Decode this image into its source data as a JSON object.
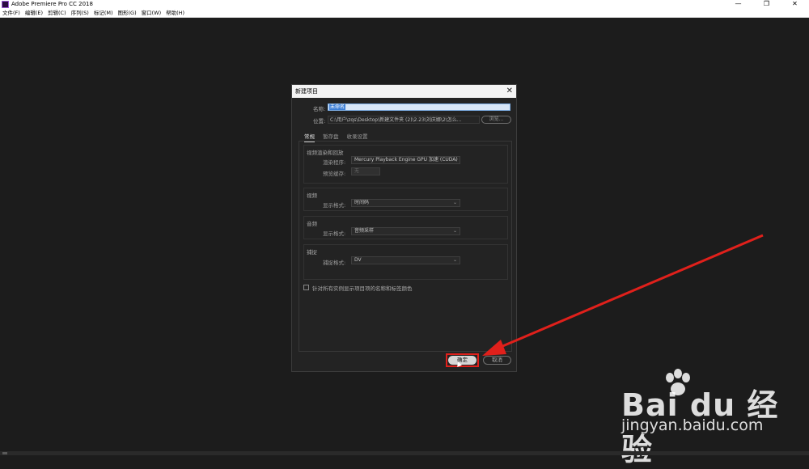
{
  "window": {
    "title": "Adobe Premiere Pro CC 2018",
    "controls": [
      "—",
      "❐",
      "✕"
    ]
  },
  "menubar": {
    "items": [
      "文件(F)",
      "编辑(E)",
      "剪辑(C)",
      "序列(S)",
      "标记(M)",
      "图形(G)",
      "窗口(W)",
      "帮助(H)"
    ]
  },
  "dialog": {
    "title": "新建项目",
    "name_label": "名称:",
    "name_value": "未命名",
    "location_label": "位置:",
    "location_value": "C:\\用户\\zqs\\Desktop\\新建文件夹 (2)\\2.23\\刘庆娜\\2\\怎么...",
    "browse_label": "浏览...",
    "tabs": [
      "常规",
      "暂存盘",
      "收录设置"
    ],
    "groups": {
      "render": {
        "title": "视频渲染和回放",
        "renderer_label": "渲染程序:",
        "renderer_value": "Mercury Playback Engine GPU 加速 (CUDA)",
        "preview_cache_label": "预览缓存:",
        "preview_cache_value": "无"
      },
      "video": {
        "title": "视频",
        "display_format_label": "显示格式:",
        "display_format_value": "时间码"
      },
      "audio": {
        "title": "音频",
        "display_format_label": "显示格式:",
        "display_format_value": "音频采样"
      },
      "capture": {
        "title": "捕捉",
        "capture_format_label": "捕捉格式:",
        "capture_format_value": "DV"
      }
    },
    "checkbox_label": "针对所有实例显示项目项的名称和标签颜色",
    "ok_label": "确定",
    "cancel_label": "取消"
  },
  "watermark": {
    "brand": "Bai du 经验",
    "url": "jingyan.baidu.com"
  },
  "colors": {
    "annotation_red": "#e0201b",
    "selection_blue": "#3d7fd6"
  }
}
